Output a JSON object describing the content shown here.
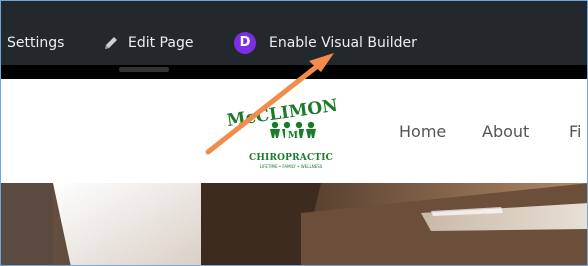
{
  "adminbar": {
    "settings_label": "Settings",
    "edit_page_label": "Edit Page",
    "visual_builder_label": "Enable Visual Builder",
    "visual_builder_badge": "D",
    "badge_color": "#7b2fe0"
  },
  "logo": {
    "alt": "McCLIMON CHIROPRACTIC",
    "subtitle": "CHIROPRACTIC",
    "tagline": "LIFETIME • FAMILY • WELLNESS",
    "brand_color": "#1b7a2c"
  },
  "nav": {
    "items": [
      "Home",
      "About",
      "Fi"
    ]
  },
  "annotation": {
    "arrow_color": "#f28c4b"
  }
}
